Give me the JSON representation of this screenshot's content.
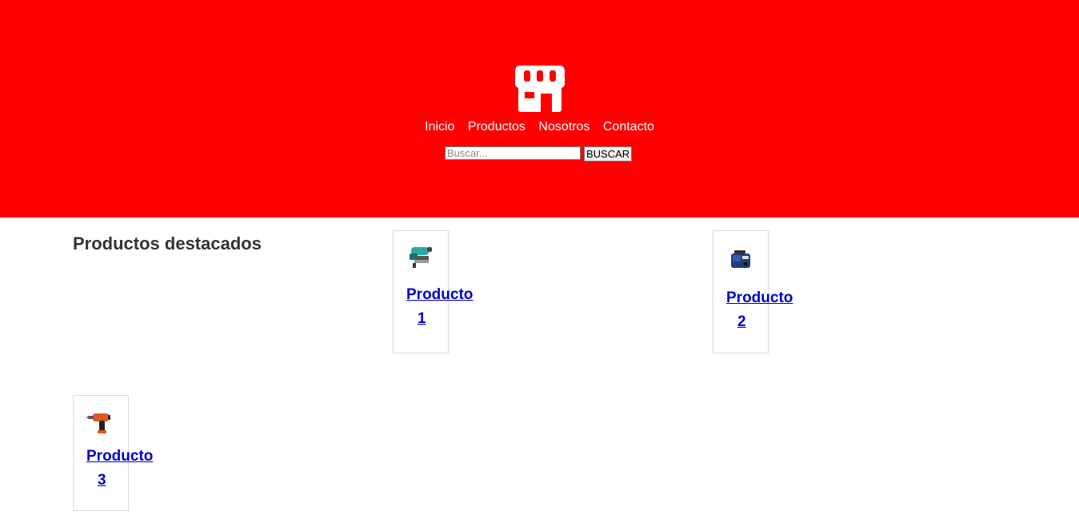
{
  "header": {
    "background": "#ff0000",
    "logo_icon": "storefront-icon",
    "nav": [
      "Inicio",
      "Productos",
      "Nosotros",
      "Contacto"
    ],
    "search": {
      "placeholder": "Buscar...",
      "value": "",
      "button_label": "BUSCAR"
    }
  },
  "main": {
    "title": "Productos destacados",
    "products": [
      {
        "name": "Producto",
        "number": "1",
        "icon": "jigsaw-tool-icon"
      },
      {
        "name": "Producto",
        "number": "2",
        "icon": "welder-machine-icon"
      },
      {
        "name": "Producto",
        "number": "3",
        "icon": "power-drill-icon"
      }
    ]
  },
  "colors": {
    "link": "#0000cc",
    "title": "#333333"
  }
}
